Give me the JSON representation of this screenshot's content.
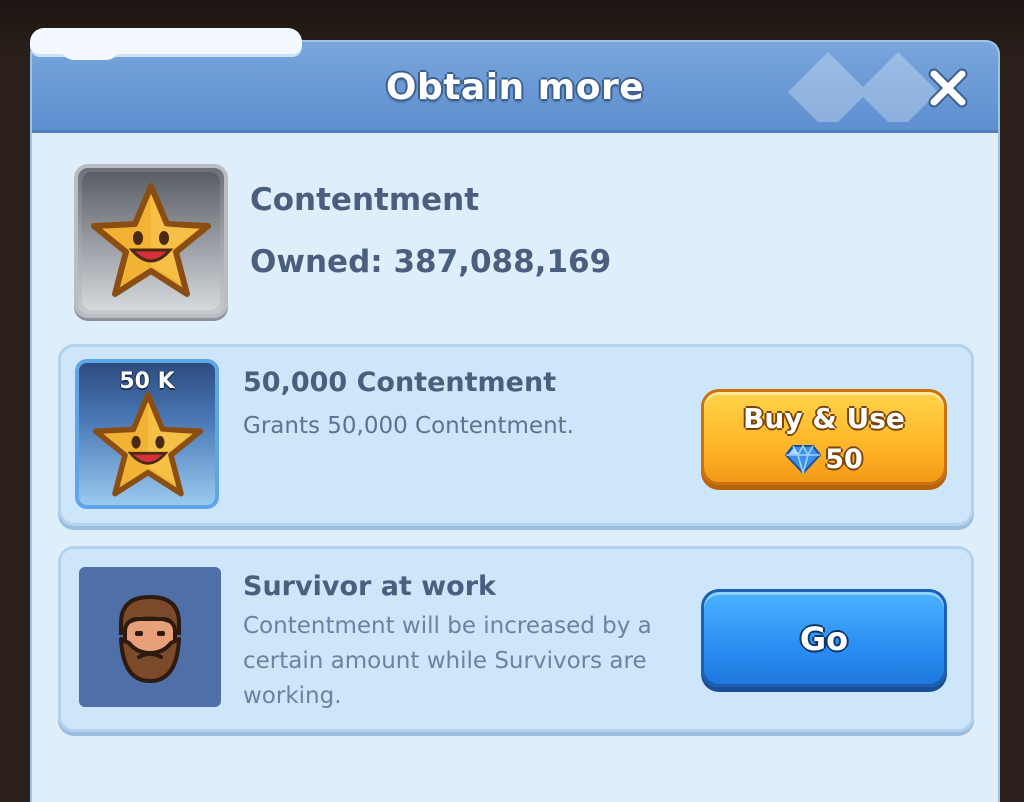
{
  "dialog": {
    "title": "Obtain more",
    "close_icon": "close-icon"
  },
  "resource": {
    "name": "Contentment",
    "owned": "Owned: 387,088,169",
    "icon": "smiling-star-icon"
  },
  "offers": [
    {
      "icon": "smiling-star-icon",
      "badge": "50 K",
      "title": "50,000 Contentment",
      "description": "Grants 50,000 Contentment.",
      "button_label": "Buy & Use",
      "cost_icon": "gem-icon",
      "cost": "50"
    },
    {
      "icon": "bearded-survivor-icon",
      "title": "Survivor at work",
      "description": "Contentment will be increased by a certain amount while Survivors are working.",
      "button_label": "Go"
    }
  ],
  "colors": {
    "header": "#6a99d6",
    "panel": "#dfeefb",
    "card": "#cde6f9",
    "buy_button": "#ffb82a",
    "go_button": "#2a8ef2",
    "text": "#4a5f7e"
  }
}
